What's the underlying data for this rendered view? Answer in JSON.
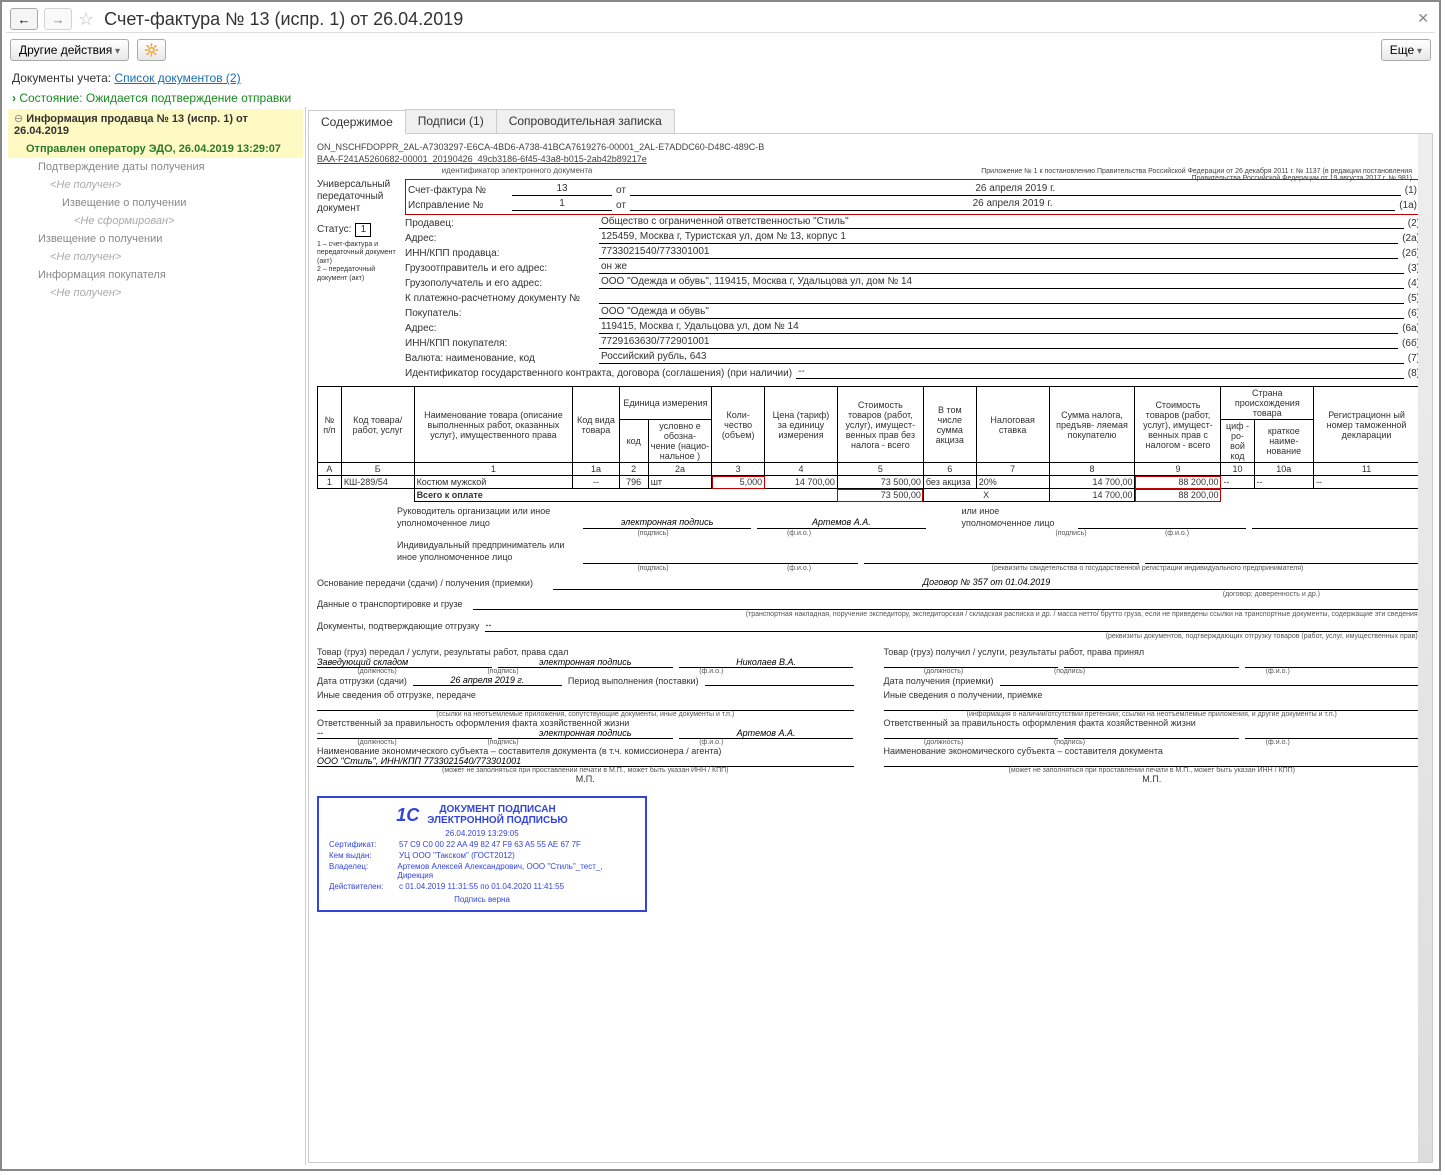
{
  "title": "Счет-фактура № 13 (испр. 1) от 26.04.2019",
  "toolbar": {
    "other_actions": "Другие действия",
    "more": "Еще"
  },
  "links": {
    "label": "Документы учета:",
    "list": "Список документов (2)"
  },
  "state": "Состояние: Ожидается подтверждение отправки",
  "tree": {
    "info": "Информация продавца № 13 (испр. 1) от 26.04.2019",
    "sent": "Отправлен оператору ЭДО, 26.04.2019 13:29:07",
    "confirm": "Подтверждение даты получения",
    "nr1": "<Не получен>",
    "notice1": "Извещение о получении",
    "nf": "<Не сформирован>",
    "notice2": "Извещение о получении",
    "nr2": "<Не получен>",
    "buyer": "Информация покупателя",
    "nr3": "<Не получен>"
  },
  "tabs": {
    "content": "Содержимое",
    "sigs": "Подписи (1)",
    "note": "Сопроводительная записка"
  },
  "doc": {
    "id1": "ON_NSCHFDOPPR_2AL-A7303297-E6CA-4BD6-A738-41BCA7619276-00001_2AL-E7ADDC60-D48C-489C-B",
    "id2": "BAA-F241A5260682-00001_20190426_49cb3186-6f45-43a8-b015-2ab42b89217e",
    "id_caption": "идентификатор электронного документа",
    "upd": "Универсальный передаточный документ",
    "status_lbl": "Статус:",
    "status_val": "1",
    "legend1": "1 – счет-фактура и передаточный документ (акт)",
    "legend2": "2 – передаточный документ (акт)",
    "sf_lbl": "Счет-фактура №",
    "sf_num": "13",
    "sf_ot": "от",
    "sf_date": "26 апреля 2019 г.",
    "n1": "(1)",
    "isp_lbl": "Исправление №",
    "isp_num": "1",
    "isp_date": "26 апреля 2019 г.",
    "n1a": "(1а)",
    "seller": "Продавец:",
    "seller_v": "Общество с ограниченной ответственностью \"Стиль\"",
    "n2": "(2)",
    "addr": "Адрес:",
    "addr_v": "125459, Москва г, Туристская ул, дом № 13, корпус 1",
    "n2a": "(2а)",
    "inn": "ИНН/КПП продавца:",
    "inn_v": "7733021540/773301001",
    "n2b": "(2б)",
    "shipper": "Грузоотправитель и его адрес:",
    "shipper_v": "он же",
    "n3": "(3)",
    "consignee": "Грузополучатель и его адрес:",
    "consignee_v": "ООО \"Одежда и обувь\", 119415, Москва г, Удальцова ул, дом № 14",
    "n4": "(4)",
    "paydoc": "К платежно-расчетному документу №",
    "paydoc_v": "",
    "n5": "(5)",
    "buyer": "Покупатель:",
    "buyer_v": "ООО \"Одежда и обувь\"",
    "n6": "(6)",
    "baddr": "Адрес:",
    "baddr_v": "119415, Москва г, Удальцова ул, дом № 14",
    "n6a": "(6а)",
    "binn": "ИНН/КПП покупателя:",
    "binn_v": "7729163630/772901001",
    "n6b": "(6б)",
    "currency": "Валюта: наименование, код",
    "currency_v": "Российский рубль, 643",
    "n7": "(7)",
    "gosid": "Идентификатор государственного контракта, договора (соглашения) (при наличии)",
    "gosid_v": "--",
    "n8": "(8)",
    "prilog": "Приложение № 1 к постановлению Правительства Российской Федерации от 26 декабря 2011 г. № 1137 (в редакции постановления Правительства Российской Федерации от 19 августа 2017 г. № 981)"
  },
  "table": {
    "h": {
      "pp": "№ п/п",
      "code": "Код товара/ работ, услуг",
      "name": "Наименование товара (описание выполненных работ, оказанных услуг), имущественного права",
      "kindcode": "Код вида товара",
      "unit": "Единица измерения",
      "unit_code": "код",
      "unit_name": "условно е обозна- чение (нацио- нальное )",
      "qty": "Коли- чество (объем)",
      "price": "Цена (тариф) за единицу измерения",
      "sum_nonds": "Стоимость товаров (работ, услуг), имущест- венных прав без налога - всего",
      "excise": "В том числе сумма акциза",
      "rate": "Налоговая ставка",
      "tax": "Сумма налога, предъяв- ляемая покупателю",
      "sum_nds": "Стоимость товаров (работ, услуг), имущест- венных прав с налогом - всего",
      "country": "Страна происхождения товара",
      "ccode": "циф - ро- вой код",
      "cname": "краткое наиме- нование",
      "decl": "Регистрационн ый номер таможенной декларации"
    },
    "idx": [
      "А",
      "Б",
      "1",
      "1а",
      "2",
      "2а",
      "3",
      "4",
      "5",
      "6",
      "7",
      "8",
      "9",
      "10",
      "10а",
      "11"
    ],
    "row": {
      "n": "1",
      "code": "КШ-289/54",
      "name": "Костюм мужской",
      "kind": "--",
      "ucode": "796",
      "uname": "шт",
      "qty": "5,000",
      "price": "14 700,00",
      "sum_no": "73 500,00",
      "excise": "без акциза",
      "rate": "20%",
      "tax": "14 700,00",
      "sum": "88 200,00",
      "cc": "--",
      "cn": "--",
      "decl": "--"
    },
    "total": {
      "lbl": "Всего к оплате",
      "sum_no": "73 500,00",
      "x": "Х",
      "tax": "14 700,00",
      "sum": "88 200,00"
    }
  },
  "sig": {
    "head": "Руководитель организации или иное уполномоченное лицо",
    "ep": "электронная подпись",
    "podsig": "(подпись)",
    "fio": "(ф.и.о.)",
    "artemov": "Артемов А.А.",
    "other": "или иное уполномоченное лицо",
    "ip": "Индивидуальный предприниматель или иное уполномоченное лицо",
    "rekv": "(реквизиты свидетельства о государственной регистрации индивидуального предпринимателя)",
    "basis": "Основание передачи (сдачи) / получения (приемки)",
    "contract": "Договор № 357 от 01.04.2019",
    "dogov": "(договор; доверенность и др.)",
    "transport": "Данные о транспортировке и грузе",
    "trans_hint": "(транспортная накладная, поручение экспедитору, экспедиторская / складская расписка и др. / масса нетто/ брутто груза, если не приведены ссылки на транспортные документы, содержащие эти сведения)",
    "confirm": "Документы, подтверждающие отгрузку",
    "dash": "--",
    "confirm_hint": "(реквизиты документов, подтверждающих отгрузку товаров (работ, услуг, имущественных прав))",
    "left": {
      "title": "Товар (груз) передал / услуги, результаты работ, права сдал",
      "pos": "Заведующий складом",
      "nik": "Николаев В.А.",
      "pos_h": "(должность)",
      "date_lbl": "Дата отгрузки (сдачи)",
      "date": "26 апреля 2019 г.",
      "period": "Период выполнения (поставки)",
      "other": "Иные сведения об отгрузке, передаче",
      "other_h": "(ссылки на неотъемлемые приложения, сопутствующие документы, иные документы и т.п.)",
      "resp": "Ответственный за правильность оформления факта хозяйственной жизни",
      "dash": "--",
      "econ": "Наименование экономического субъекта – составителя документа (в т.ч. комиссионера / агента)",
      "econ_v": "ООО \"Стиль\", ИНН/КПП 7733021540/773301001",
      "mp_h": "(может не заполняться при проставлении печати в М.П., может быть указан ИНН / КПП)",
      "mp": "М.П."
    },
    "right": {
      "title": "Товар (груз) получил / услуги, результаты работ, права принял",
      "date_lbl": "Дата получения (приемки)",
      "other": "Иные сведения о получении, приемке",
      "other_h": "(информация о наличии/отсутствии претензии; ссылки на неотъемлемые приложения, и другие документы и т.п.)",
      "resp": "Ответственный за правильность оформления факта хозяйственной жизни",
      "econ": "Наименование экономического субъекта – составителя документа",
      "mp": "М.П."
    }
  },
  "stamp": {
    "title1": "ДОКУМЕНТ ПОДПИСАН",
    "title2": "ЭЛЕКТРОННОЙ ПОДПИСЬЮ",
    "ts": "26.04.2019 13:29:05",
    "cert_l": "Сертификат:",
    "cert": "57 C9 C0 00 22 AA 49 82 47 F9 63 A5 55 AE 67 7F",
    "issued_l": "Кем выдан:",
    "issued": "УЦ ООО \"Такском\" (ГОСТ2012)",
    "owner_l": "Владелец:",
    "owner": "Артемов Алексей Александрович, ООО \"Стиль\"_тест_, Дирекция",
    "valid_l": "Действителен:",
    "valid": "с 01.04.2019 11:31:55 по 01.04.2020 11:41:55",
    "ok": "Подпись верна"
  }
}
